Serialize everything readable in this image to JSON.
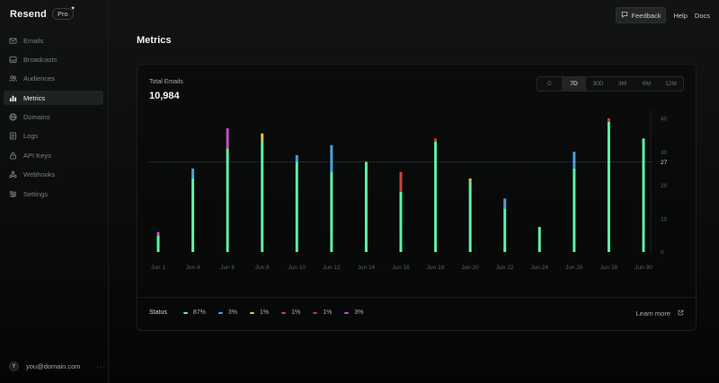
{
  "app": {
    "name": "Resend",
    "plan_badge": "Pro"
  },
  "sidebar": {
    "items": [
      {
        "label": "Emails",
        "icon": "mail-icon",
        "active": false
      },
      {
        "label": "Broadcasts",
        "icon": "inbox-icon",
        "active": false
      },
      {
        "label": "Audiences",
        "icon": "users-icon",
        "active": false
      },
      {
        "label": "Metrics",
        "icon": "bar-chart-icon",
        "active": true
      },
      {
        "label": "Domains",
        "icon": "globe-icon",
        "active": false
      },
      {
        "label": "Logs",
        "icon": "logs-icon",
        "active": false
      },
      {
        "label": "API Keys",
        "icon": "lock-icon",
        "active": false
      },
      {
        "label": "Webhooks",
        "icon": "webhook-icon",
        "active": false
      },
      {
        "label": "Settings",
        "icon": "sliders-icon",
        "active": false
      }
    ],
    "user": {
      "avatar_initial": "Y",
      "email": "you@domain.com",
      "menu": "···"
    }
  },
  "topbar": {
    "feedback": "Feedback",
    "help": "Help",
    "docs": "Docs"
  },
  "page": {
    "title": "Metrics"
  },
  "metrics": {
    "label": "Total Emails",
    "value": "10,984",
    "ranges": [
      "D",
      "7D",
      "30D",
      "3M",
      "6M",
      "12M"
    ],
    "active_range": "7D"
  },
  "status": {
    "label": "Status",
    "items": [
      {
        "percent": "87%",
        "color": "#5ef0a8"
      },
      {
        "percent": "3%",
        "color": "#4e9fd8"
      },
      {
        "percent": "1%",
        "color": "#e8c33a"
      },
      {
        "percent": "1%",
        "color": "#c8453f"
      },
      {
        "percent": "1%",
        "color": "#b13a3a"
      },
      {
        "percent": "3%",
        "color": "#c14fbf"
      }
    ],
    "learn_more": "Learn more"
  },
  "chart_data": {
    "type": "bar",
    "stacked": true,
    "categories": [
      "Jun 1",
      "Jun 2",
      "Jun 3",
      "Jun 4",
      "Jun 5",
      "Jun 6",
      "Jun 7",
      "Jun 8",
      "Jun 9",
      "Jun 10",
      "Jun 11",
      "Jun 12",
      "Jun 13",
      "Jun 14",
      "Jun 15",
      "Jun 16",
      "Jun 17",
      "Jun 18",
      "Jun 19",
      "Jun 20",
      "Jun 21",
      "Jun 22",
      "Jun 23",
      "Jun 24",
      "Jun 25",
      "Jun 26",
      "Jun 27",
      "Jun 28",
      "Jun 29",
      "Jun 30"
    ],
    "x_tick_labels": [
      "Jun 1",
      "Jun 4",
      "Jun 6",
      "Jun 8",
      "Jun 10",
      "Jun 12",
      "Jun 14",
      "Jun 16",
      "Jun 18",
      "Jun 20",
      "Jun 22",
      "Jun 24",
      "Jun 26",
      "Jun 28",
      "Jun 30"
    ],
    "series": [
      {
        "color": "#5ef0a8",
        "values": [
          5,
          0,
          0,
          22,
          0,
          0,
          31,
          0,
          0,
          33,
          0,
          0,
          29,
          0,
          0,
          24,
          0,
          0,
          27,
          0,
          0,
          18,
          0,
          0,
          32,
          0,
          0,
          21,
          0,
          0
        ]
      },
      {
        "color": "#4e9fd8",
        "values": [
          0,
          0,
          0,
          3,
          0,
          0,
          0,
          0,
          0,
          0,
          0,
          0,
          2,
          0,
          0,
          8,
          0,
          0,
          0,
          0,
          0,
          0,
          0,
          0,
          0,
          0,
          0,
          0,
          0,
          0
        ]
      },
      {
        "color": "#e8c33a",
        "values": [
          0,
          0,
          0,
          0,
          0,
          0,
          0,
          0,
          0,
          2.5,
          0,
          0,
          0,
          0,
          0,
          0,
          0,
          0,
          0,
          0,
          0,
          0,
          0,
          0,
          0,
          0,
          0,
          1,
          0,
          0
        ]
      },
      {
        "color": "#c8453f",
        "values": [
          0,
          0,
          0,
          0,
          0,
          0,
          0,
          0,
          0,
          0,
          0,
          0,
          0,
          0,
          0,
          0,
          0,
          0,
          0,
          0,
          0,
          6,
          0,
          0,
          1,
          0,
          0,
          0,
          0,
          0
        ]
      },
      {
        "color": "#c14fbf",
        "values": [
          1,
          0,
          0,
          0,
          0,
          0,
          6,
          0,
          0,
          0,
          0,
          0,
          0,
          0,
          0,
          0,
          0,
          0,
          0,
          0,
          0,
          0,
          0,
          0,
          0,
          0,
          0,
          0,
          0,
          0
        ]
      }
    ],
    "bars": [
      {
        "x": "Jun 1",
        "segments": [
          5,
          0,
          0,
          0,
          1
        ]
      },
      {
        "x": "Jun 4",
        "segments": [
          22,
          3,
          0,
          0,
          0
        ]
      },
      {
        "x": "Jun 6",
        "segments": [
          31,
          0,
          0,
          0,
          6
        ]
      },
      {
        "x": "Jun 8",
        "segments": [
          33,
          0,
          2.5,
          0,
          0
        ]
      },
      {
        "x": "Jun 10",
        "segments": [
          27,
          2,
          0,
          0,
          0
        ]
      },
      {
        "x": "Jun 12",
        "segments": [
          24,
          8,
          0,
          0,
          0
        ]
      },
      {
        "x": "Jun 14",
        "segments": [
          27,
          0,
          0,
          0,
          0
        ]
      },
      {
        "x": "Jun 16",
        "segments": [
          18,
          0,
          0,
          6,
          0
        ]
      },
      {
        "x": "Jun 18",
        "segments": [
          33,
          0,
          0,
          1,
          0
        ]
      },
      {
        "x": "Jun 20",
        "segments": [
          21,
          0,
          1,
          0,
          0
        ]
      },
      {
        "x": "Jun 22",
        "segments": [
          13,
          3,
          0,
          0,
          0
        ]
      },
      {
        "x": "Jun 24",
        "segments": [
          7.5,
          0,
          0,
          0,
          0
        ]
      },
      {
        "x": "Jun 26",
        "segments": [
          25,
          5,
          0,
          0,
          0
        ]
      },
      {
        "x": "Jun 28",
        "segments": [
          39,
          0,
          0,
          1,
          0
        ]
      },
      {
        "x": "Jun 30",
        "segments": [
          34,
          0,
          0,
          0,
          0
        ]
      }
    ],
    "y_ticks": [
      0,
      10,
      20,
      30,
      40
    ],
    "ylim": [
      0,
      40
    ],
    "reference_line": 27,
    "grid": false
  }
}
